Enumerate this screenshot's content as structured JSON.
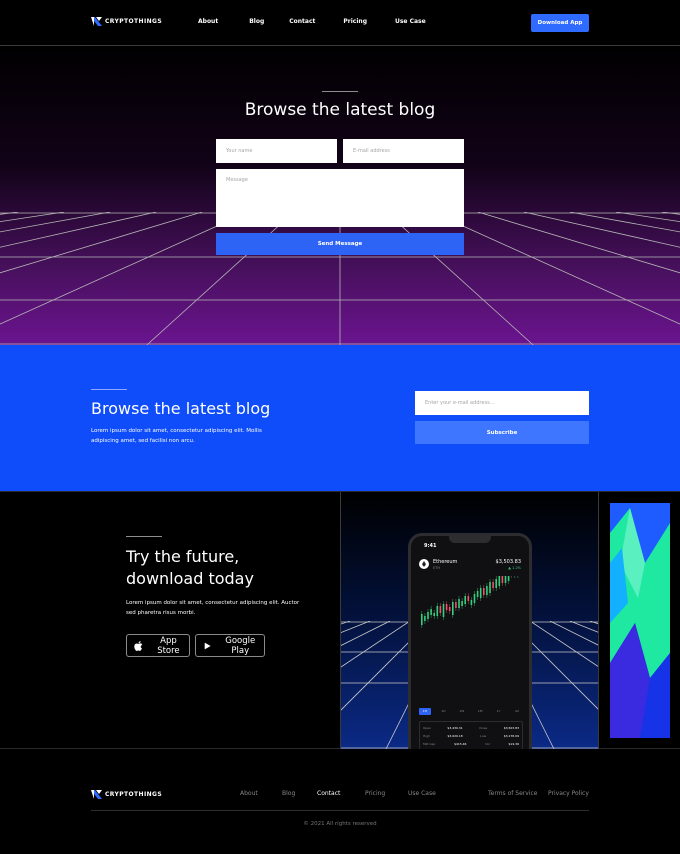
{
  "header": {
    "brand": "CRYPTOTHINGS",
    "nav": [
      "About",
      "Blog",
      "Contact",
      "Pricing",
      "Use Case"
    ],
    "cta": "Download App"
  },
  "contact_section": {
    "title": "Browse the latest blog",
    "name_placeholder": "Your name",
    "email_placeholder": "E-mail address",
    "message_placeholder": "Message",
    "submit": "Send Message"
  },
  "newsletter_section": {
    "title": "Browse the latest blog",
    "text": "Lorem ipsum dolor sit amet, consectetur adipiscing elit. Mollis adipiscing amet, sed facilisi non arcu.",
    "email_placeholder": "Enter your e-mail address...",
    "submit": "Subscribe"
  },
  "download_section": {
    "title_line1": "Try the future,",
    "title_line2": "download today",
    "text": "Lorem ipsum dolor sit amet, consectetur adipiscing elit. Auctor sed pharetra risus morbi.",
    "app_store": "App Store",
    "google_play": "Google Play",
    "phone": {
      "time": "9:41",
      "coin": "Ethereum",
      "symbol": "ETH",
      "price": "$3,503.83",
      "change": "▲ 1.2%",
      "tabs": [
        "1H",
        "1D",
        "1W",
        "1M",
        "1Y",
        "All"
      ],
      "stats": [
        [
          "Open",
          "$3,430.31",
          "Close",
          "$3,503.83"
        ],
        [
          "High",
          "$3,620.18",
          "Low",
          "$3,178.09"
        ],
        [
          "Mkt Cap",
          "$415.46",
          "Vol",
          "$19.36"
        ]
      ]
    }
  },
  "footer": {
    "brand": "CRYPTOTHINGS",
    "nav": [
      "About",
      "Blog",
      "Contact",
      "Pricing",
      "Use Case"
    ],
    "legal": [
      "Terms of Service",
      "Privacy Policy"
    ],
    "copyright": "© 2021 All rights reserved"
  },
  "colors": {
    "accent": "#2f6bff",
    "newsletter_bg": "#0f4dfa",
    "gradient_purple": "#6b1490"
  }
}
